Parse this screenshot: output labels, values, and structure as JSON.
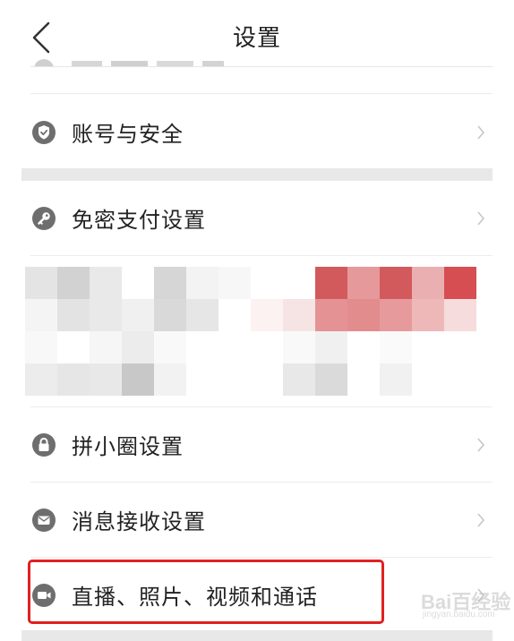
{
  "header": {
    "title": "设置"
  },
  "rows": [
    {
      "label": "账号与安全",
      "icon": "shield-check-icon"
    },
    {
      "label": "免密支付设置",
      "icon": "key-icon"
    },
    {
      "label": "拼小圈设置",
      "icon": "lock-icon"
    },
    {
      "label": "消息接收设置",
      "icon": "mail-icon"
    },
    {
      "label": "直播、照片、视频和通话",
      "icon": "video-camera-icon"
    }
  ],
  "watermark": {
    "text": "Bai百经验",
    "sub": "jingyan.baidu.com"
  },
  "colors": {
    "highlight": "#e02020",
    "separator": "#e8e8e8",
    "icon": "#6e6e6e"
  }
}
